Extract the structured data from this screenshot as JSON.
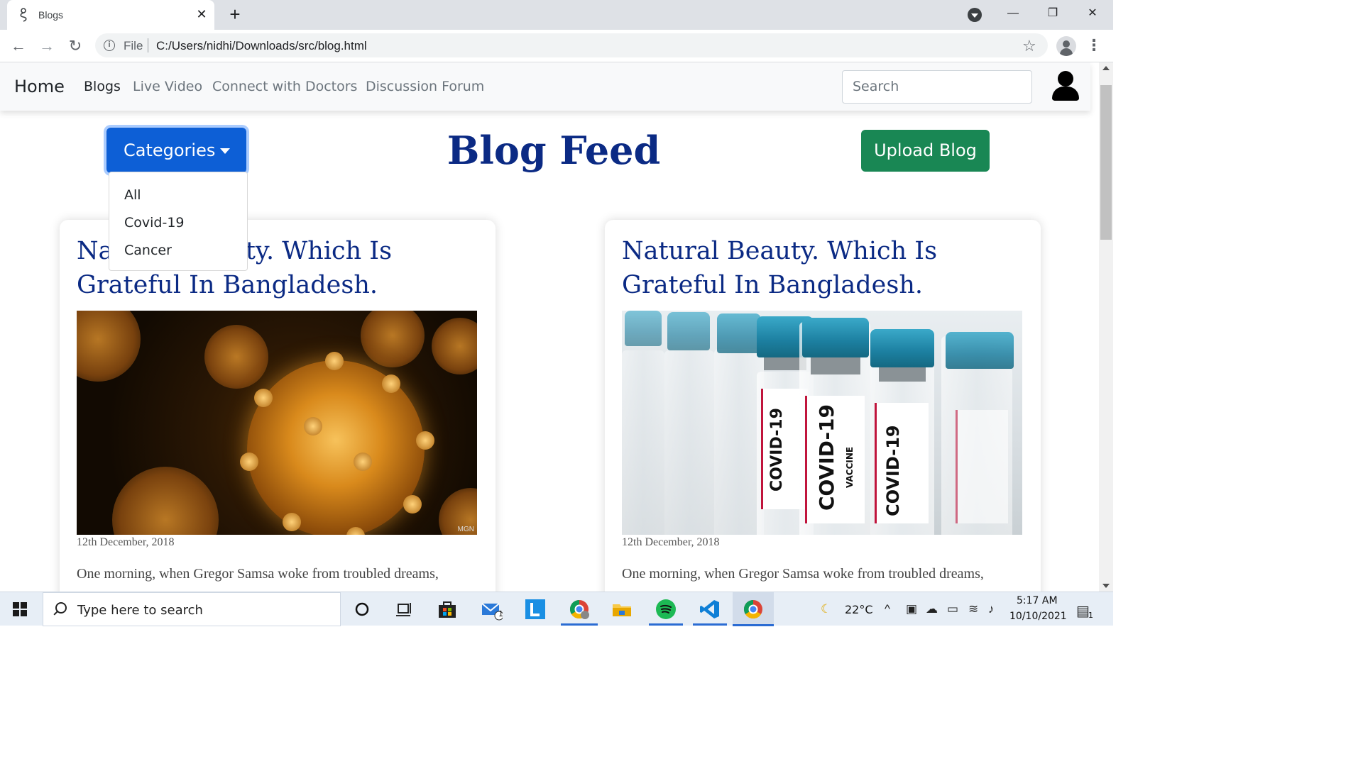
{
  "browser": {
    "tab_title": "Blogs",
    "tab_close": "✕",
    "new_tab": "+",
    "window_controls": {
      "minimize": "—",
      "restore": "❐",
      "close": "✕"
    },
    "nav": {
      "back": "←",
      "forward": "→",
      "reload": "↻"
    },
    "info_glyph": "i",
    "scheme_label": "File",
    "url": "C:/Users/nidhi/Downloads/src/blog.html",
    "bookmark_glyph": "☆",
    "menu_glyph": "⋮"
  },
  "site": {
    "brand": "Home",
    "nav_links": [
      "Blogs",
      "Live Video",
      "Connect with Doctors",
      "Discussion Forum"
    ],
    "active_link": "Blogs",
    "search_placeholder": "Search",
    "heading": "Blog Feed",
    "categories_label": "Categories",
    "categories_options": [
      "All",
      "Covid-19",
      "Cancer"
    ],
    "upload_label": "Upload Blog",
    "colors": {
      "heading": "#0b2a84",
      "primary": "#0d5fd6",
      "success": "#198754"
    }
  },
  "posts": [
    {
      "title": "Natural Beauty. Which Is Grateful In Bangladesh.",
      "image": "coronavirus-icon",
      "image_credit": "MGN",
      "date": "12th December, 2018",
      "excerpt": "One morning, when Gregor Samsa woke from troubled dreams,"
    },
    {
      "title": "Natural Beauty. Which Is Grateful In Bangladesh.",
      "image": "vaccine-vials-icon",
      "vial_label": "COVID-19",
      "vial_sublabel": "VACCINE",
      "date": "12th December, 2018",
      "excerpt": "One morning, when Gregor Samsa woke from troubled dreams,"
    }
  ],
  "taskbar": {
    "search_placeholder": "Type here to search",
    "mail_badge": "1",
    "weather_temp": "22°C",
    "time": "5:17 AM",
    "date": "10/10/2021",
    "notification_badge": "1"
  }
}
